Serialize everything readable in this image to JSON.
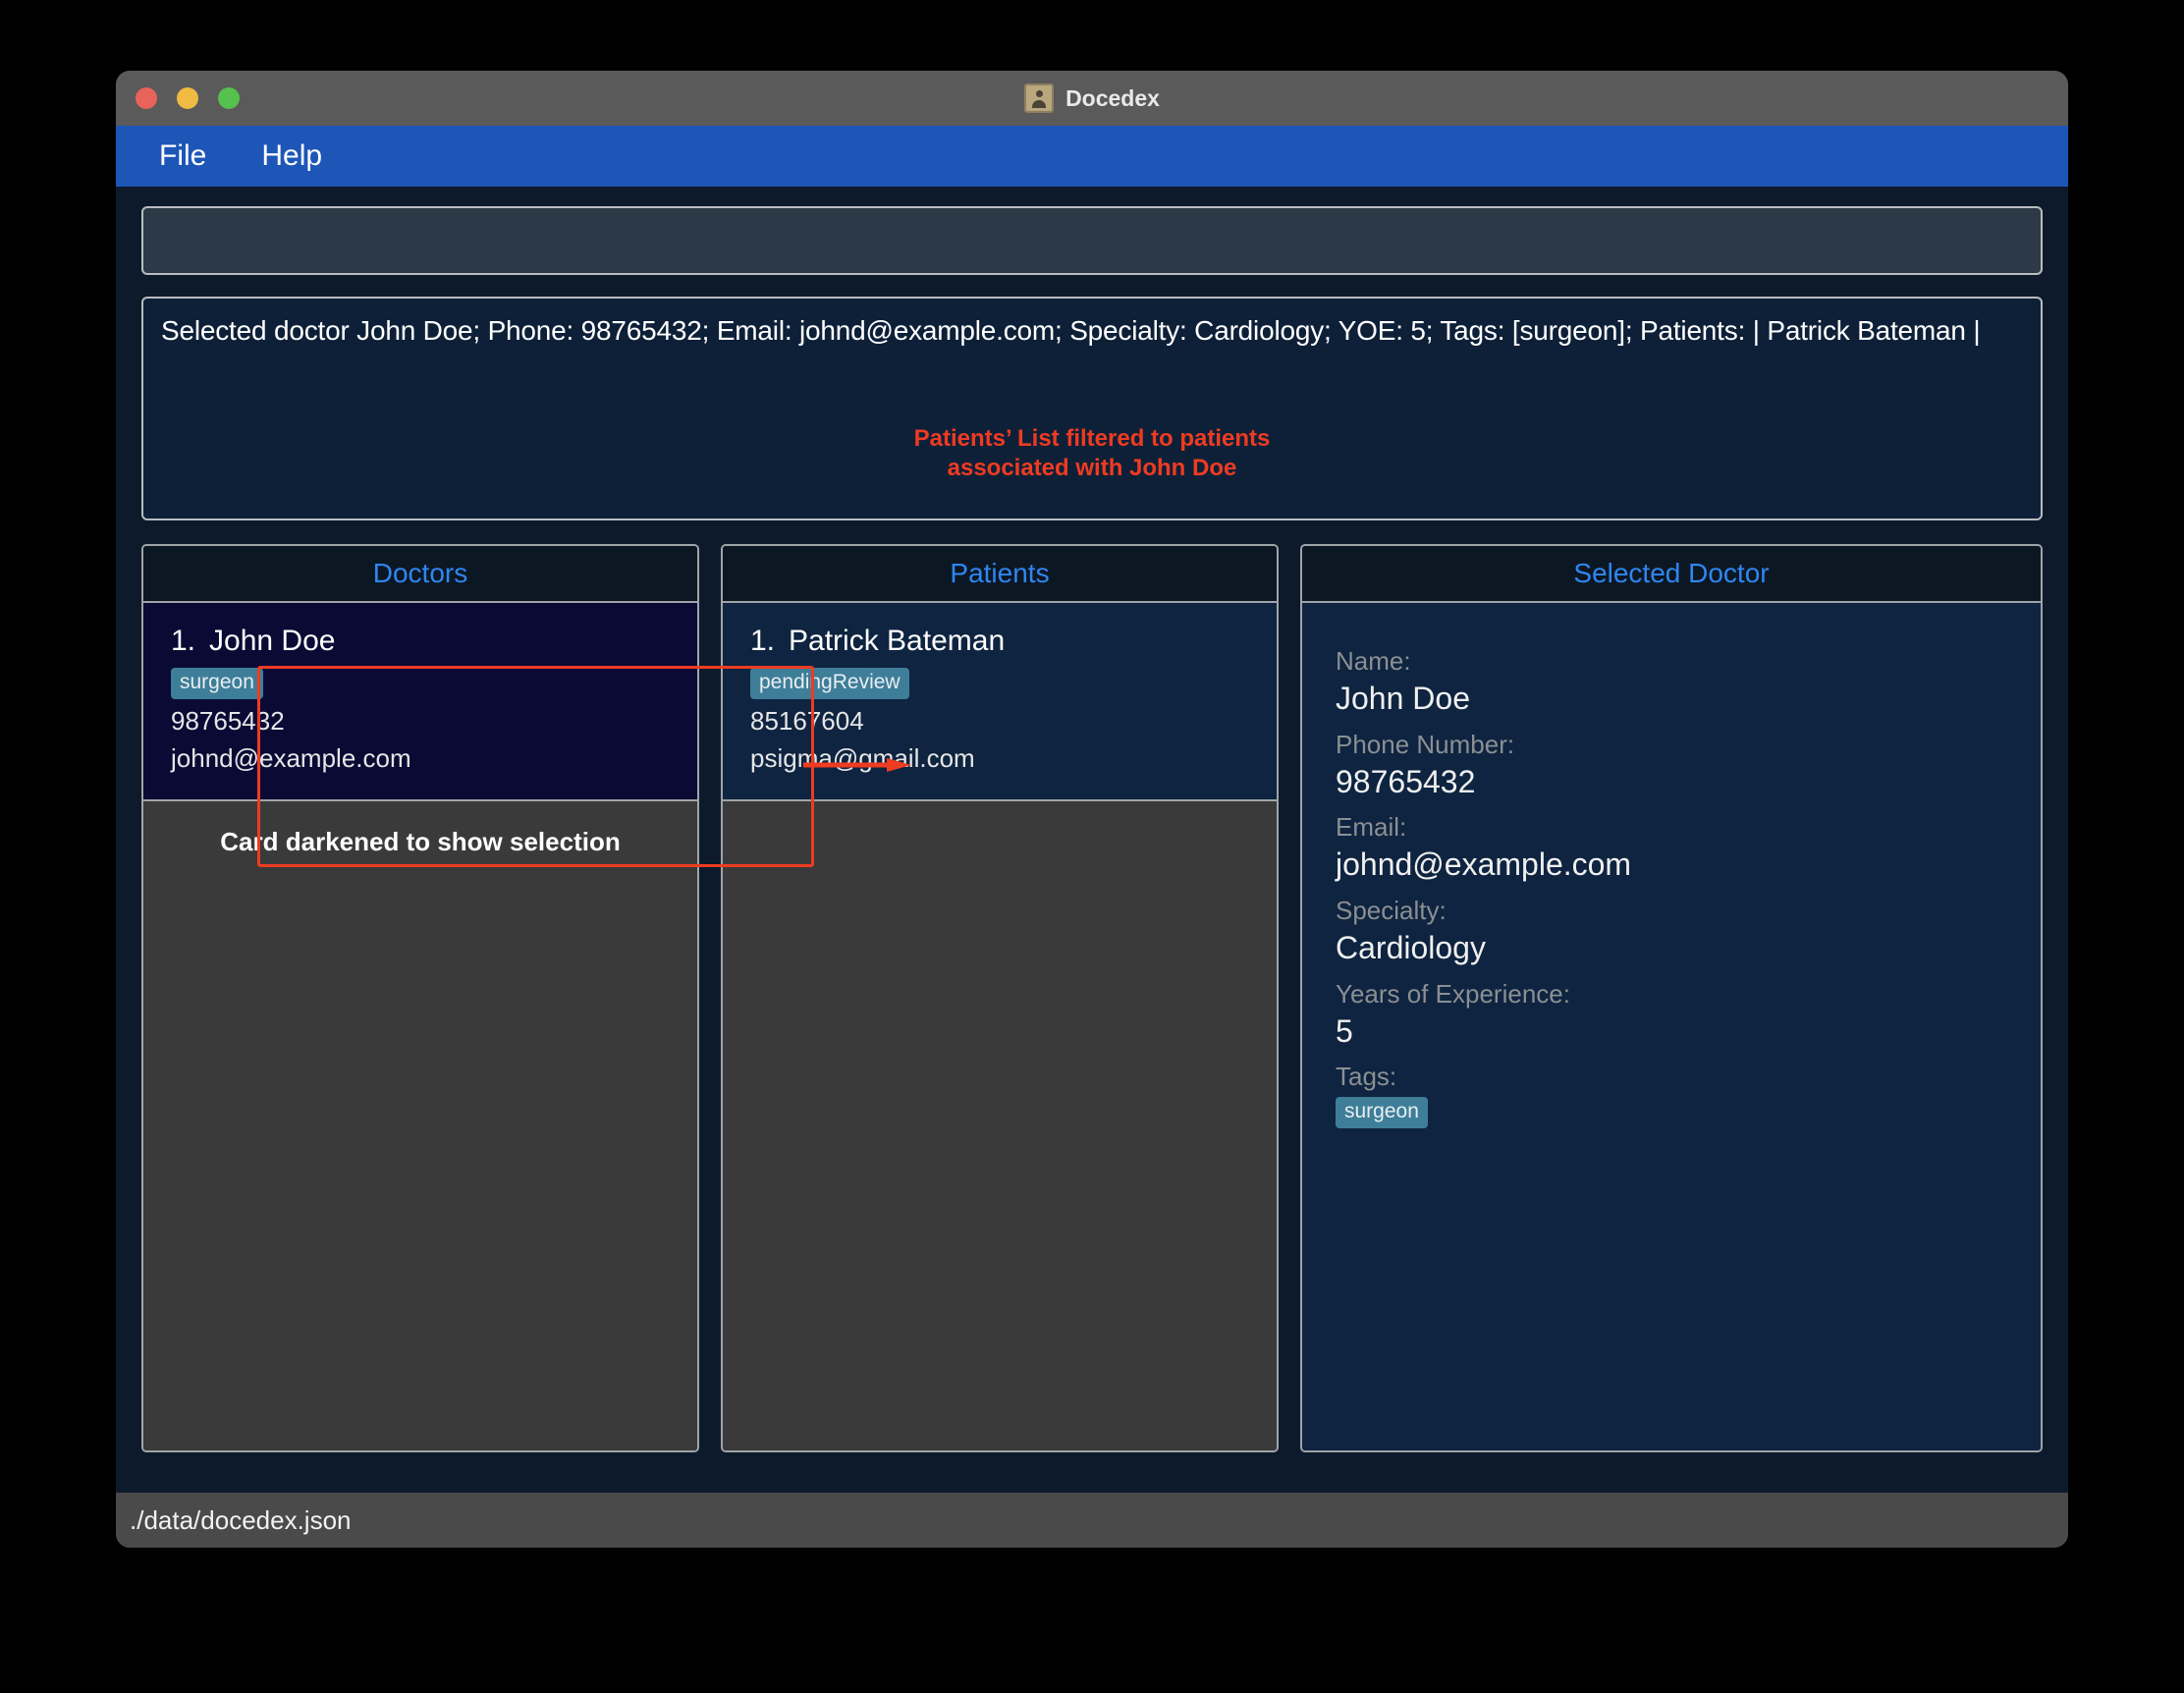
{
  "window": {
    "title": "Docedex",
    "app_icon": "address-book-icon",
    "traffic_lights": [
      "close-red",
      "minimize-yellow",
      "maximize-green"
    ]
  },
  "menu": {
    "items": [
      {
        "label": "File"
      },
      {
        "label": "Help"
      }
    ]
  },
  "command_box": {
    "value": "",
    "placeholder": ""
  },
  "result_box": {
    "text": "Selected doctor John Doe; Phone: 98765432; Email: johnd@example.com; Specialty: Cardiology; YOE: 5; Tags: [surgeon]; Patients: | Patrick Bateman |"
  },
  "annotations": {
    "filter_note_line1": "Patients’ List filtered to patients",
    "filter_note_line2": "associated with John Doe",
    "darkened_note": "Card darkened to show selection",
    "accent_color": "#ee3b21"
  },
  "panels": {
    "doctors": {
      "header": "Doctors",
      "cards": [
        {
          "index": "1.",
          "name": "John Doe",
          "tag": "surgeon",
          "phone": "98765432",
          "email": "johnd@example.com",
          "selected": true
        }
      ]
    },
    "patients": {
      "header": "Patients",
      "cards": [
        {
          "index": "1.",
          "name": "Patrick Bateman",
          "tag": "pendingReview",
          "phone": "85167604",
          "email": "psigma@gmail.com",
          "selected": false
        }
      ]
    },
    "selected_doctor": {
      "header": "Selected Doctor",
      "fields": [
        {
          "label": "Name:",
          "value": "John Doe"
        },
        {
          "label": "Phone Number:",
          "value": "98765432"
        },
        {
          "label": "Email:",
          "value": "johnd@example.com"
        },
        {
          "label": "Specialty:",
          "value": "Cardiology"
        },
        {
          "label": "Years of Experience:",
          "value": "5"
        }
      ],
      "tags_label": "Tags:",
      "tags": [
        "surgeon"
      ]
    }
  },
  "status_bar": {
    "path": "./data/docedex.json"
  },
  "colors": {
    "menu_blue": "#1e56b8",
    "panel_title_blue": "#2f86f0",
    "tag_teal": "#3e7e99",
    "annotation_red": "#ee3b21",
    "selected_card_navy": "#0a0a35",
    "card_navy": "#0e2440"
  }
}
